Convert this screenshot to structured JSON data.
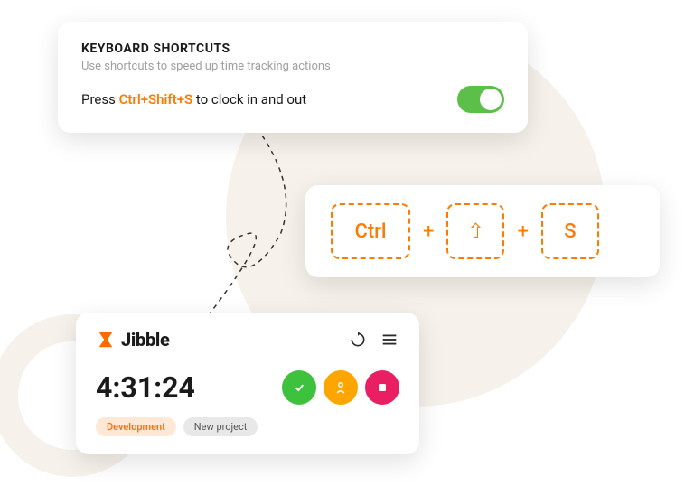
{
  "shortcuts": {
    "title": "KEYBOARD SHORTCUTS",
    "subtitle": "Use shortcuts to speed up time tracking actions",
    "press": "Press ",
    "hotkey": "Ctrl+Shift+S",
    "after": " to clock in and out"
  },
  "keys": {
    "k1": "Ctrl",
    "k2": "⇧",
    "k3": "S",
    "plus": "+"
  },
  "tracker": {
    "brand": "Jibble",
    "time": "4:31:24",
    "tag1": "Development",
    "tag2": "New project"
  }
}
